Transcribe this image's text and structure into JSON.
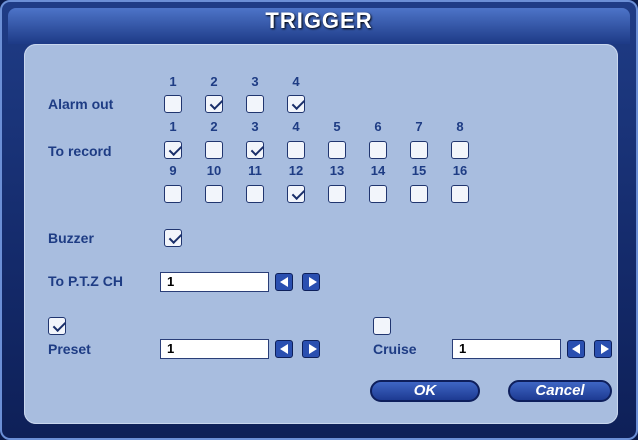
{
  "title": "TRIGGER",
  "alarm_out": {
    "label": "Alarm out",
    "channels": [
      {
        "n": "1",
        "checked": false
      },
      {
        "n": "2",
        "checked": true
      },
      {
        "n": "3",
        "checked": false
      },
      {
        "n": "4",
        "checked": true
      }
    ]
  },
  "to_record": {
    "label": "To record",
    "channels": [
      {
        "n": "1",
        "checked": true
      },
      {
        "n": "2",
        "checked": false
      },
      {
        "n": "3",
        "checked": true
      },
      {
        "n": "4",
        "checked": false
      },
      {
        "n": "5",
        "checked": false
      },
      {
        "n": "6",
        "checked": false
      },
      {
        "n": "7",
        "checked": false
      },
      {
        "n": "8",
        "checked": false
      },
      {
        "n": "9",
        "checked": false
      },
      {
        "n": "10",
        "checked": false
      },
      {
        "n": "11",
        "checked": false
      },
      {
        "n": "12",
        "checked": true
      },
      {
        "n": "13",
        "checked": false
      },
      {
        "n": "14",
        "checked": false
      },
      {
        "n": "15",
        "checked": false
      },
      {
        "n": "16",
        "checked": false
      }
    ]
  },
  "buzzer": {
    "label": "Buzzer",
    "checked": true
  },
  "ptz": {
    "label": "To P.T.Z CH",
    "value": "1"
  },
  "preset": {
    "label": "Preset",
    "checked": true,
    "value": "1"
  },
  "cruise": {
    "label": "Cruise",
    "checked": false,
    "value": "1"
  },
  "buttons": {
    "ok": "OK",
    "cancel": "Cancel"
  },
  "icons": {
    "prev": "left-arrow-icon",
    "next": "right-arrow-icon"
  }
}
